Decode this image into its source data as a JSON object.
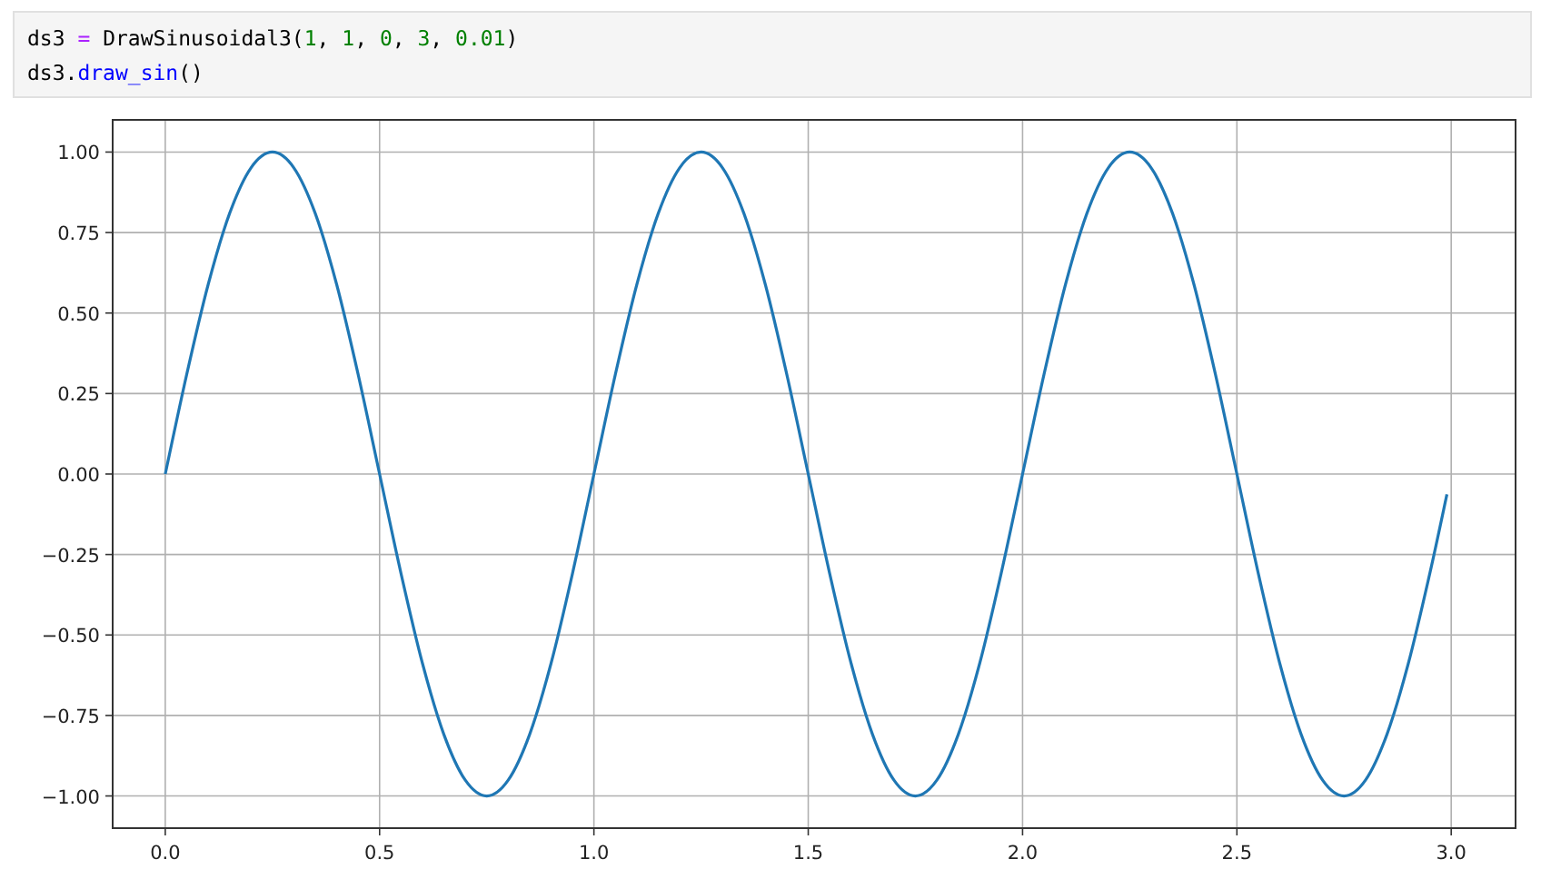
{
  "code_cell": {
    "lines": [
      [
        {
          "text": "ds3 ",
          "kind": "name"
        },
        {
          "text": "=",
          "kind": "operator"
        },
        {
          "text": " DrawSinusoidal3(",
          "kind": "name"
        },
        {
          "text": "1",
          "kind": "number"
        },
        {
          "text": ", ",
          "kind": "name"
        },
        {
          "text": "1",
          "kind": "number"
        },
        {
          "text": ", ",
          "kind": "name"
        },
        {
          "text": "0",
          "kind": "number"
        },
        {
          "text": ", ",
          "kind": "name"
        },
        {
          "text": "3",
          "kind": "number"
        },
        {
          "text": ", ",
          "kind": "name"
        },
        {
          "text": "0.01",
          "kind": "number"
        },
        {
          "text": ")",
          "kind": "name"
        }
      ],
      [
        {
          "text": "ds3.",
          "kind": "name"
        },
        {
          "text": "draw_sin",
          "kind": "function"
        },
        {
          "text": "()",
          "kind": "name"
        }
      ]
    ]
  },
  "output": {
    "chart_data": {
      "type": "line",
      "x": [
        0,
        0.05,
        0.1,
        0.15,
        0.2,
        0.25,
        0.3,
        0.35,
        0.4,
        0.45,
        0.5,
        0.55,
        0.6,
        0.65,
        0.7,
        0.75,
        0.8,
        0.85,
        0.9,
        0.95,
        1,
        1.05,
        1.1,
        1.15,
        1.2,
        1.25,
        1.3,
        1.35,
        1.4,
        1.45,
        1.5,
        1.55,
        1.6,
        1.65,
        1.7,
        1.75,
        1.8,
        1.85,
        1.9,
        1.95,
        2,
        2.05,
        2.1,
        2.15,
        2.2,
        2.25,
        2.3,
        2.35,
        2.4,
        2.45,
        2.5,
        2.55,
        2.6,
        2.65,
        2.7,
        2.75,
        2.8,
        2.85,
        2.9,
        2.95,
        2.99
      ],
      "series": [
        {
          "color": "#1f77b4",
          "values": [
            0,
            0.309,
            0.588,
            0.809,
            0.951,
            1,
            0.951,
            0.809,
            0.588,
            0.309,
            0,
            -0.309,
            -0.588,
            -0.809,
            -0.951,
            -1,
            -0.951,
            -0.809,
            -0.588,
            -0.309,
            0,
            0.309,
            0.588,
            0.809,
            0.951,
            1,
            0.951,
            0.809,
            0.588,
            0.309,
            0,
            -0.309,
            -0.588,
            -0.809,
            -0.951,
            -1,
            -0.951,
            -0.809,
            -0.588,
            -0.309,
            0,
            0.309,
            0.588,
            0.809,
            0.951,
            1,
            0.951,
            0.809,
            0.588,
            0.309,
            0,
            -0.309,
            -0.588,
            -0.809,
            -0.951,
            -1,
            -0.951,
            -0.809,
            -0.588,
            -0.309,
            -0.063
          ]
        }
      ],
      "xlim": [
        -0.1227,
        3.1501
      ],
      "ylim": [
        -1.1,
        1.1
      ],
      "grid": true,
      "xticks": [
        {
          "value": 0,
          "label": "0.0"
        },
        {
          "value": 0.5,
          "label": "0.5"
        },
        {
          "value": 1,
          "label": "1.0"
        },
        {
          "value": 1.5,
          "label": "1.5"
        },
        {
          "value": 2,
          "label": "2.0"
        },
        {
          "value": 2.5,
          "label": "2.5"
        },
        {
          "value": 3,
          "label": "3.0"
        }
      ],
      "yticks": [
        {
          "value": -1,
          "label": "−1.00"
        },
        {
          "value": -0.75,
          "label": "−0.75"
        },
        {
          "value": -0.5,
          "label": "−0.50"
        },
        {
          "value": -0.25,
          "label": "−0.25"
        },
        {
          "value": 0,
          "label": "0.00"
        },
        {
          "value": 0.25,
          "label": "0.25"
        },
        {
          "value": 0.5,
          "label": "0.50"
        },
        {
          "value": 0.75,
          "label": "0.75"
        },
        {
          "value": 1,
          "label": "1.00"
        }
      ]
    }
  }
}
